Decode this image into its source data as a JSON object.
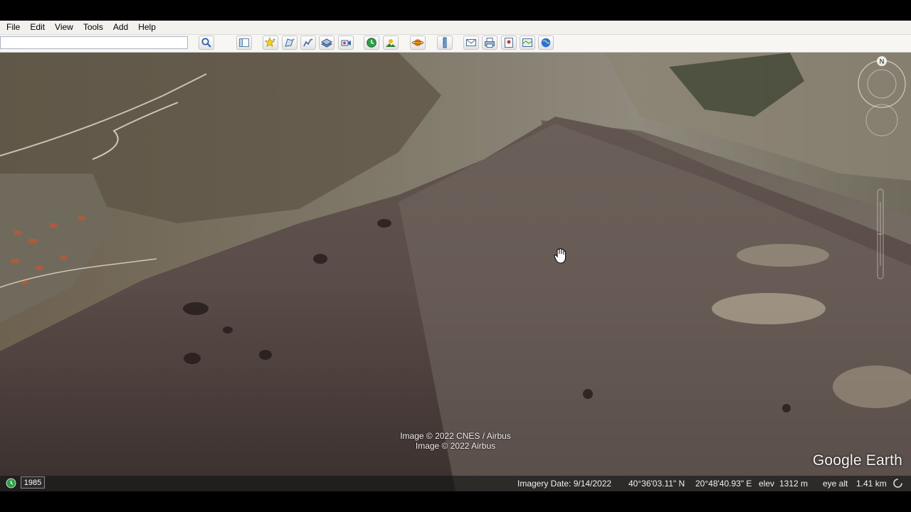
{
  "menu": [
    {
      "label": "File",
      "name": "menu-file"
    },
    {
      "label": "Edit",
      "name": "menu-edit"
    },
    {
      "label": "View",
      "name": "menu-view"
    },
    {
      "label": "Tools",
      "name": "menu-tools"
    },
    {
      "label": "Add",
      "name": "menu-add"
    },
    {
      "label": "Help",
      "name": "menu-help"
    }
  ],
  "search": {
    "value": "",
    "placeholder": ""
  },
  "toolbar_icons": [
    "search-icon",
    "sidebar-toggle-icon",
    "placemark-icon",
    "polygon-icon",
    "path-icon",
    "overlay-icon",
    "tour-icon",
    "historical-imagery-icon",
    "sunlight-icon",
    "planets-icon",
    "ruler-icon",
    "email-icon",
    "print-icon",
    "save-image-icon",
    "view-in-maps-icon",
    "google-earth-icon"
  ],
  "attribution": {
    "line1": "Image © 2022 CNES / Airbus",
    "line2": "Image © 2022 Airbus"
  },
  "brand": "Google Earth",
  "compass": {
    "north_label": "N"
  },
  "status": {
    "year": "1985",
    "imagery_date": "Imagery Date: 9/14/2022",
    "latitude": "40°36'03.11\" N",
    "longitude": "20°48'40.93\" E",
    "elev_label": "elev",
    "elev_value": "1312 m",
    "eye_alt_label": "eye alt",
    "eye_alt_value": "1.41 km"
  },
  "colors": {
    "menubar": "#f2f1ee",
    "toolbar": "#f7f6f3",
    "status_bg": "#141414"
  }
}
